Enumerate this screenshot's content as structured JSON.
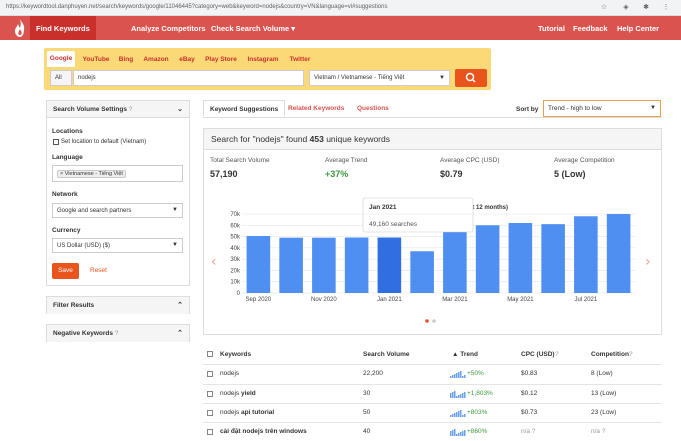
{
  "browser": {
    "url": "https://keywordtool.danphuyen.net/search/keywords/google/11046445?category=web&keyword=nodejs&country=VN&language=vi#suggestions"
  },
  "colors": {
    "brand": "#d9534f",
    "accent": "#e8541c",
    "tabs_bg": "#fcd977",
    "bar": "#4f8ff2",
    "bar_highlight": "#2f6fe0",
    "trend_up": "#3c9a3c"
  },
  "nav": {
    "items": [
      "Find Keywords",
      "Analyze Competitors",
      "Check Search Volume ▾"
    ],
    "right": [
      "Tutorial",
      "Feedback",
      "Help Center"
    ]
  },
  "source_tabs": [
    "Google",
    "YouTube",
    "Bing",
    "Amazon",
    "eBay",
    "Play Store",
    "Instagram",
    "Twitter"
  ],
  "search": {
    "scope": "All",
    "keyword": "nodejs",
    "location": "Vietnam / Vietnamese - Tiếng Việt"
  },
  "sidebar": {
    "settings_title": "Search Volume Settings",
    "locations_label": "Locations",
    "set_default_label": "Set location to default (Vietnam)",
    "language_label": "Language",
    "language_chip": "× Vietnamese - Tiếng Việt",
    "network_label": "Network",
    "network_value": "Google and search partners",
    "currency_label": "Currency",
    "currency_value": "US Dollar (USD) ($)",
    "save_label": "Save",
    "reset_label": "Reset",
    "filter_title": "Filter Results",
    "negative_title": "Negative Keywords"
  },
  "results_tabs": [
    "Keyword Suggestions",
    "Related Keywords",
    "Questions"
  ],
  "sort": {
    "label": "Sort by",
    "value": "Trend - high to low"
  },
  "summary": {
    "head_prefix": "Search for \"nodejs\" found ",
    "count": "453",
    "head_suffix": " unique keywords",
    "stats": [
      {
        "label": "Total Search Volume",
        "value": "57,190"
      },
      {
        "label": "Average Trend",
        "value": "+37%"
      },
      {
        "label": "Average CPC (USD)",
        "value": "$0.79"
      },
      {
        "label": "Average Competition",
        "value": "5 (Low)"
      }
    ]
  },
  "chart_data": {
    "type": "bar",
    "title": "(last 12 months)",
    "categories": [
      "Sep 2020",
      "Oct 2020",
      "Nov 2020",
      "Dec 2020",
      "Jan 2021",
      "Feb 2021",
      "Mar 2021",
      "Apr 2021",
      "May 2021",
      "Jun 2021",
      "Jul 2021",
      "Aug 2021"
    ],
    "x_tick_labels": [
      "Sep 2020",
      "Nov 2020",
      "Jan 2021",
      "Mar 2021",
      "May 2021",
      "Jul 2021"
    ],
    "values": [
      50500,
      49000,
      49000,
      49160,
      49160,
      37000,
      61000,
      60000,
      62000,
      61000,
      68000,
      70000
    ],
    "ylim": [
      0,
      70000
    ],
    "y_ticks": [
      "0",
      "10k",
      "20k",
      "30k",
      "40k",
      "50k",
      "60k",
      "70k"
    ],
    "highlight_index": 4,
    "tooltip": {
      "title": "Jan 2021",
      "text": "49,160 searches"
    }
  },
  "table": {
    "headers": [
      "Keywords",
      "Search Volume",
      "▲ Trend",
      "CPC (USD)",
      "Competition"
    ],
    "rows": [
      {
        "kw_plain": "nodejs",
        "kw_bold": "",
        "volume": "22,200",
        "trend": "+50%",
        "cpc": "$0.83",
        "comp": "8 (Low)"
      },
      {
        "kw_plain": "nodejs ",
        "kw_bold": "yield",
        "volume": "30",
        "trend": "+1,803%",
        "cpc": "$0.12",
        "comp": "13 (Low)"
      },
      {
        "kw_plain": "nodejs ",
        "kw_bold": "api tutorial",
        "volume": "50",
        "trend": "+803%",
        "cpc": "$0.73",
        "comp": "23 (Low)"
      },
      {
        "kw_plain": "",
        "kw_bold": "cài đặt nodejs trên windows",
        "volume": "40",
        "trend": "+860%",
        "cpc": "n/a ?",
        "comp": "n/a ?"
      }
    ]
  }
}
